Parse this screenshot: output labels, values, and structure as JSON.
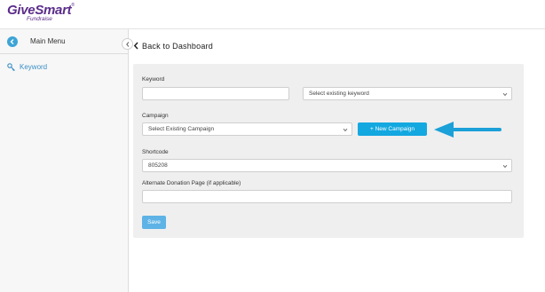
{
  "brand": {
    "name": "GiveSmart",
    "tm": "®",
    "sub": "Fundraise"
  },
  "sidebar": {
    "menu_label": "Main Menu",
    "items": [
      {
        "label": "Keyword",
        "icon": "key-icon"
      }
    ]
  },
  "header": {
    "back_label": "Back to Dashboard"
  },
  "form": {
    "keyword_label": "Keyword",
    "keyword_value": "",
    "existing_keyword_placeholder": "Select existing keyword",
    "campaign_label": "Campaign",
    "campaign_select": "Select Existing Campaign",
    "new_campaign_label": "+ New Campaign",
    "shortcode_label": "Shortcode",
    "shortcode_value": "805208",
    "alt_donation_label": "Alternate Donation Page (if applicable)",
    "alt_donation_value": "",
    "save_label": "Save"
  },
  "colors": {
    "brand": "#5b2d8a",
    "accent": "#14a8e0",
    "save": "#5db3e6",
    "link": "#3a8fc4"
  }
}
